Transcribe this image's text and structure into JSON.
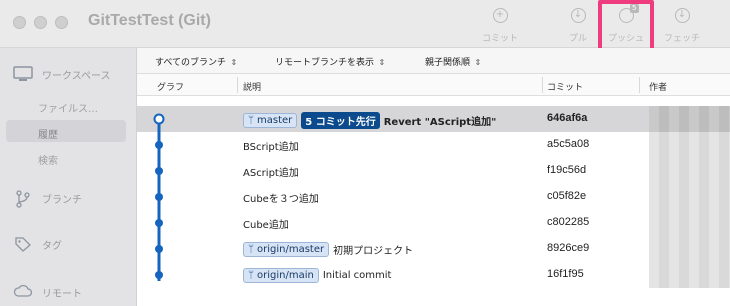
{
  "window": {
    "title": "GitTestTest (Git)"
  },
  "toolbar": {
    "commit_label": "コミット",
    "pull_label": "プル",
    "push_label": "プッシュ",
    "push_badge": "5",
    "fetch_label": "フェッチ",
    "highlight_color": "#ee3c7f"
  },
  "sidebar": {
    "workspace_label": "ワークスペース",
    "items": [
      {
        "label": "ファイルス…"
      },
      {
        "label": "履歴"
      },
      {
        "label": "検索"
      }
    ],
    "branches_label": "ブランチ",
    "tags_label": "タグ",
    "remotes_label": "リモート"
  },
  "filters": {
    "branches": "すべてのブランチ",
    "remote": "リモートブランチを表示",
    "order": "親子関係順"
  },
  "columns": {
    "graph": "グラフ",
    "description": "説明",
    "commit": "コミット",
    "author": "作者"
  },
  "commits": [
    {
      "branch": "master",
      "ahead": "5 コミット先行",
      "message": "Revert \"AScript追加\"",
      "hash": "646af6a"
    },
    {
      "message": "BScript追加",
      "hash": "a5c5a08"
    },
    {
      "message": "AScript追加",
      "hash": "f19c56d"
    },
    {
      "message": "Cubeを３つ追加",
      "hash": "c05f82e"
    },
    {
      "message": "Cube追加",
      "hash": "c802285"
    },
    {
      "branch": "origin/master",
      "message": "初期プロジェクト",
      "hash": "8926ce9"
    },
    {
      "branch": "origin/main",
      "message": "Initial commit",
      "hash": "16f1f95"
    }
  ],
  "colors": {
    "graph_line": "#1565c0",
    "ahead_badge": "#0b4a8c"
  }
}
